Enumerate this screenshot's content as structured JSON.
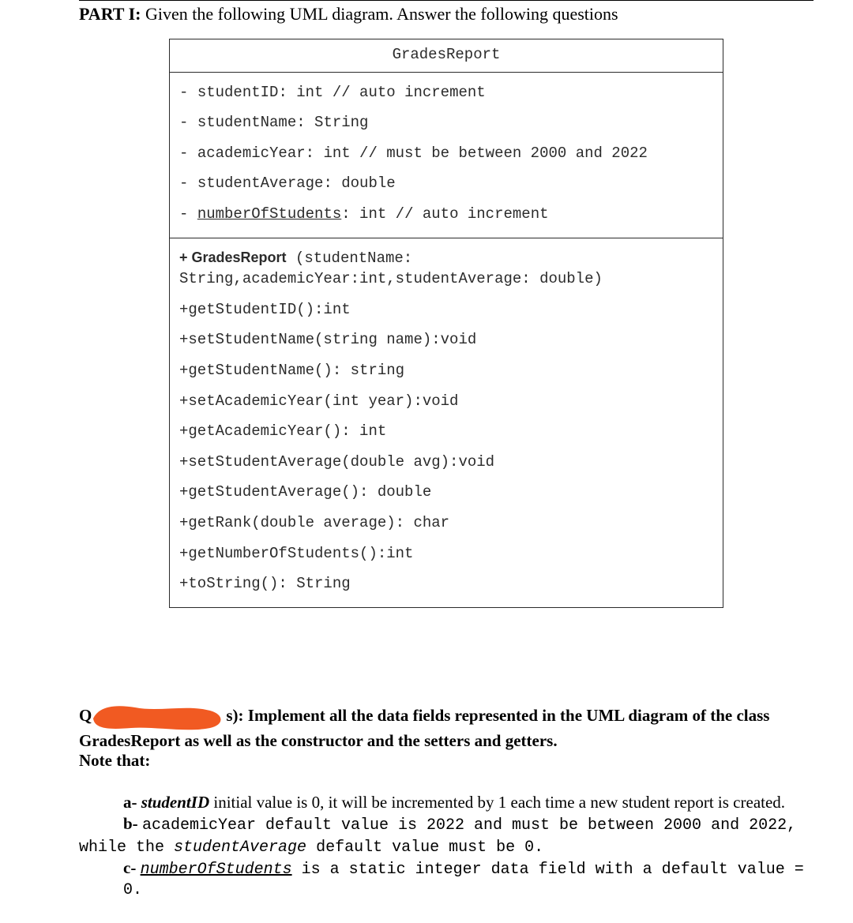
{
  "header": {
    "part_label": "PART I:",
    "part_text": " Given the following UML diagram. Answer the following questions"
  },
  "uml": {
    "class_name": "GradesReport",
    "attributes": [
      {
        "prefix": "- ",
        "name": "studentID",
        "rest": ": int // auto increment",
        "static": false
      },
      {
        "prefix": "- ",
        "name": "studentName",
        "rest": ": String",
        "static": false
      },
      {
        "prefix": "- ",
        "name": "academicYear",
        "rest": ": int // must be between 2000 and 2022",
        "static": false
      },
      {
        "prefix": "- ",
        "name": "studentAverage",
        "rest": ": double",
        "static": false
      },
      {
        "prefix": "- ",
        "name": "numberOfStudents",
        "rest": ": int // auto increment",
        "static": true
      }
    ],
    "ops_first_bold": "+ GradesReport",
    "ops_first_rest": "  (studentName:",
    "ops_second": "String,academicYear:int,studentAverage: double)",
    "ops_rest": [
      "+getStudentID():int",
      "+setStudentName(string name):void",
      "+getStudentName(): string",
      "+setAcademicYear(int year):void",
      "+getAcademicYear(): int",
      "+setStudentAverage(double avg):void",
      "+getStudentAverage(): double",
      "+getRank(double average): char",
      "+getNumberOfStudents():int",
      "+toString(): String"
    ]
  },
  "question": {
    "prefix_visible": "Q",
    "suffix_visible": "s): ",
    "line1_bold": "Implement all the data fields represented in the UML diagram of the class",
    "line2_bold_pre": "GradesReport as well as the constructor and the setters and getters.",
    "line3_bold": "Note that:"
  },
  "notes": {
    "a_label": "a- ",
    "a_italic": "studentID",
    "a_rest": " initial value is 0, it will be incremented by 1 each time a new student report is created.",
    "b_label": "b- ",
    "b_mono1": "academicYear",
    "b_mono_rest": " default value is 2022 and must be between 2000 and 2022,",
    "b_line2_pre": "while the ",
    "b_line2_mono": "studentAverage",
    "b_line2_rest": " default value must be 0.",
    "c_label": "c- ",
    "c_mono_underline": "numberOfStudents",
    "c_rest": " is a static integer data field with a default value = 0."
  }
}
